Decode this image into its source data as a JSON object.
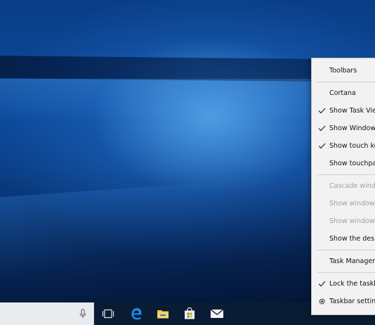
{
  "context_menu": {
    "items": [
      {
        "label": "Toolbars",
        "checked": false,
        "enabled": true,
        "icon": ""
      },
      {
        "label": "Cortana",
        "checked": false,
        "enabled": true,
        "icon": ""
      },
      {
        "label": "Show Task View",
        "checked": true,
        "enabled": true,
        "icon": "check-icon"
      },
      {
        "label": "Show Windows",
        "checked": true,
        "enabled": true,
        "icon": "check-icon"
      },
      {
        "label": "Show touch key",
        "checked": true,
        "enabled": true,
        "icon": "check-icon"
      },
      {
        "label": "Show touchpad",
        "checked": false,
        "enabled": true,
        "icon": ""
      },
      {
        "label": "Cascade window",
        "checked": false,
        "enabled": false,
        "icon": ""
      },
      {
        "label": "Show windows",
        "checked": false,
        "enabled": false,
        "icon": ""
      },
      {
        "label": "Show windows",
        "checked": false,
        "enabled": false,
        "icon": ""
      },
      {
        "label": "Show the deskto",
        "checked": false,
        "enabled": true,
        "icon": ""
      },
      {
        "label": "Task Manager",
        "checked": false,
        "enabled": true,
        "icon": ""
      },
      {
        "label": "Lock the taskba",
        "checked": true,
        "enabled": true,
        "icon": "check-icon"
      },
      {
        "label": "Taskbar settings",
        "checked": false,
        "enabled": true,
        "icon": "gear-icon"
      }
    ]
  },
  "taskbar": {
    "icons": [
      "microphone-icon",
      "task-view-icon",
      "edge-icon",
      "file-explorer-icon",
      "store-icon",
      "mail-icon"
    ]
  },
  "colors": {
    "accent": "#0078d7",
    "taskbar": "#0a1c33",
    "menu_bg": "#f2f2f2",
    "explorer_yellow": "#f5c542"
  }
}
